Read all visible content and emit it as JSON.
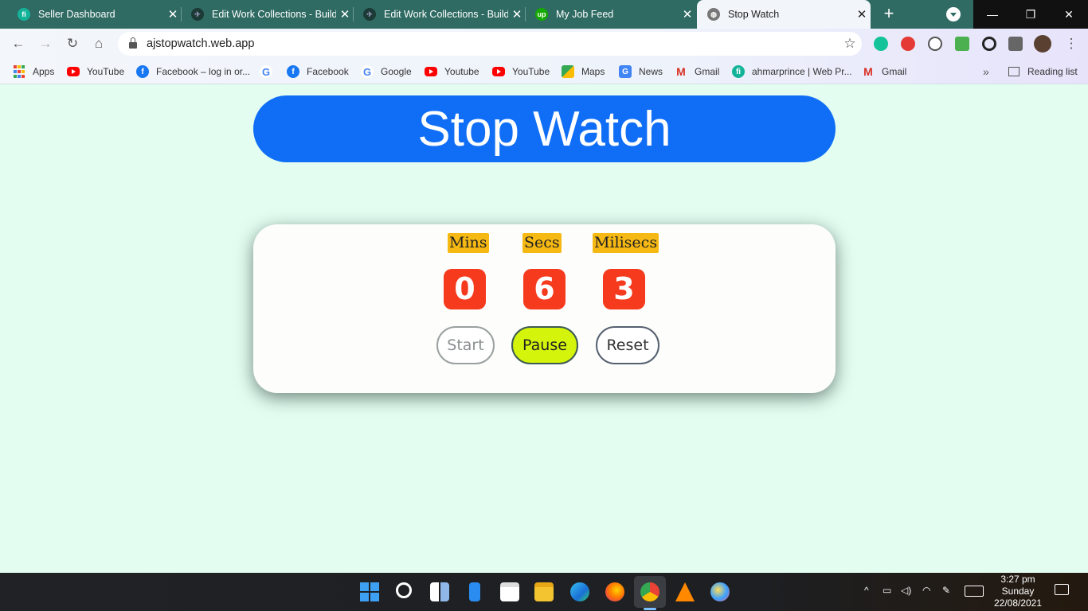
{
  "browser": {
    "tabs": [
      {
        "title": "Seller Dashboard",
        "icon": "fiverr-icon",
        "active": false
      },
      {
        "title": "Edit Work Collections - Build",
        "icon": "behance-icon",
        "active": false
      },
      {
        "title": "Edit Work Collections - Build",
        "icon": "behance-icon",
        "active": false
      },
      {
        "title": "My Job Feed",
        "icon": "upwork-icon",
        "active": false
      },
      {
        "title": "Stop Watch",
        "icon": "globe-icon",
        "active": true
      }
    ],
    "url": "ajstopwatch.web.app",
    "bookmarks": [
      {
        "label": "Apps",
        "icon": "apps-icon"
      },
      {
        "label": "YouTube",
        "icon": "youtube-icon"
      },
      {
        "label": "Facebook – log in or...",
        "icon": "facebook-icon"
      },
      {
        "label": "",
        "icon": "google-icon"
      },
      {
        "label": "Facebook",
        "icon": "facebook-icon"
      },
      {
        "label": "Google",
        "icon": "google-icon"
      },
      {
        "label": "Youtube",
        "icon": "youtube-icon"
      },
      {
        "label": "YouTube",
        "icon": "youtube-icon"
      },
      {
        "label": "Maps",
        "icon": "maps-icon"
      },
      {
        "label": "News",
        "icon": "news-icon"
      },
      {
        "label": "Gmail",
        "icon": "gmail-icon"
      },
      {
        "label": "ahmarprince | Web Pr...",
        "icon": "fiverr-icon"
      },
      {
        "label": "Gmail",
        "icon": "gmail-icon"
      }
    ],
    "overflow_label": "»",
    "reading_list": "Reading list"
  },
  "page": {
    "title": "Stop Watch",
    "units": {
      "mins_label": "Mins",
      "secs_label": "Secs",
      "milisecs_label": "Milisecs"
    },
    "values": {
      "mins": "0",
      "secs": "6",
      "milisecs": "3"
    },
    "buttons": {
      "start": "Start",
      "pause": "Pause",
      "reset": "Reset"
    },
    "colors": {
      "banner": "#0f6ef5",
      "digit_bg": "#f63a1d",
      "label_bg": "#f6b913",
      "pause_bg": "#d4f40c",
      "page_bg": "#e3fdf1"
    }
  },
  "taskbar": {
    "clock": {
      "time": "3:27 pm",
      "day": "Sunday",
      "date": "22/08/2021"
    },
    "apps": [
      "start-icon",
      "search-icon",
      "widgets-icon",
      "phone-icon",
      "store-icon",
      "file-explorer-icon",
      "edge-icon",
      "firefox-icon",
      "chrome-icon",
      "vlc-icon",
      "paint-icon"
    ]
  }
}
